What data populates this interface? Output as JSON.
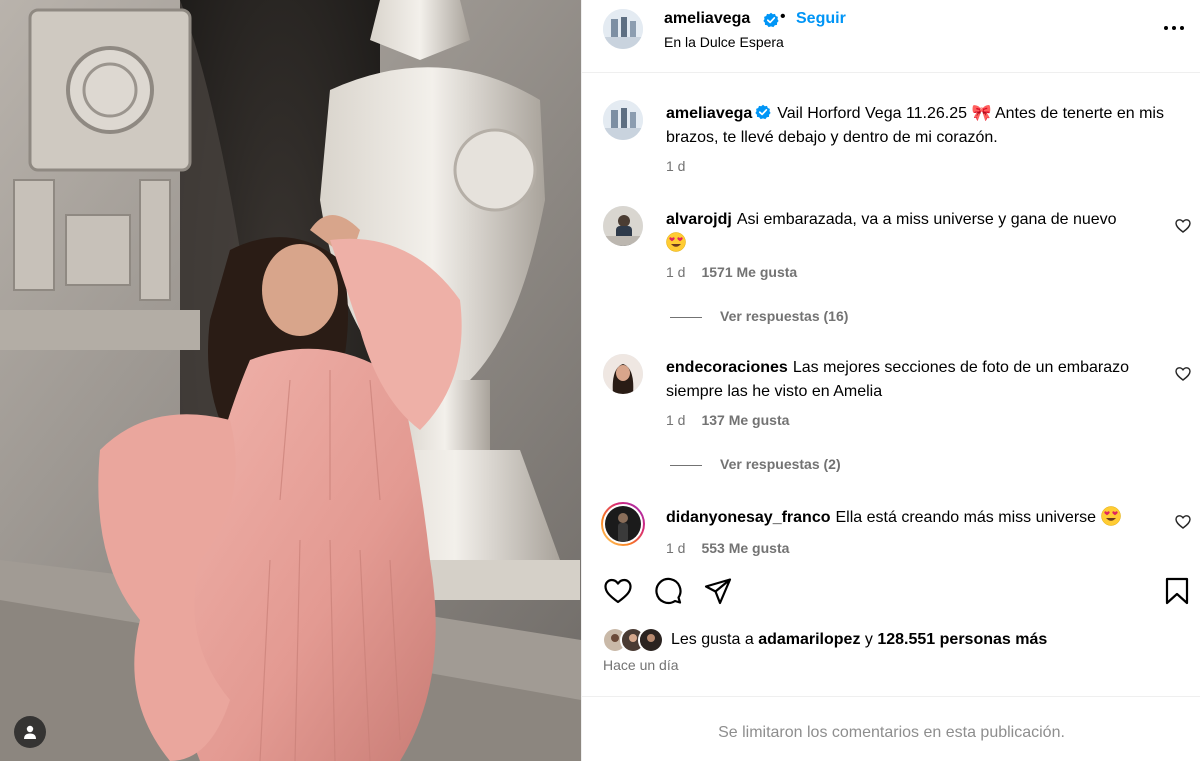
{
  "post": {
    "author": "ameliavega",
    "follow_label": "Seguir",
    "separator": "•",
    "location": "En la Dulce Espera",
    "caption": "Vail Horford Vega 11.26.25 🎀 Antes de tenerte en mis brazos, te llevé debajo y dentro de mi corazón.",
    "caption_time": "1 d",
    "time_ago": "Hace un día",
    "likes_prefix": "Les gusta a",
    "likes_user": "adamarilopez",
    "likes_joiner": "y",
    "likes_rest": "128.551 personas más",
    "comments_limited": "Se limitaron los comentarios en esta publicación.",
    "verified_color": "#0095f6"
  },
  "comments": [
    {
      "user": "alvarojdj",
      "text": "Asi embarazada, va a miss universe y gana de nuevo",
      "emoji": "heart-eyes",
      "time": "1 d",
      "likes": "1571 Me gusta",
      "replies": "Ver respuestas (16)"
    },
    {
      "user": "endecoraciones",
      "text": "Las mejores secciones de foto de un embarazo siempre las he visto en Amelia",
      "time": "1 d",
      "likes": "137 Me gusta",
      "replies": "Ver respuestas (2)"
    },
    {
      "user": "didanyonesay_franco",
      "text": "Ella está creando más miss universe",
      "emoji": "heart-eyes",
      "time": "1 d",
      "likes": "553 Me gusta"
    }
  ],
  "icons": {
    "like": "heart-icon",
    "comment": "comment-icon",
    "share": "share-icon",
    "save": "bookmark-icon",
    "more": "more-icon",
    "user": "user-icon"
  },
  "colors": {
    "accent": "#0095f6",
    "muted": "#737373",
    "dress": "#e8a39c"
  }
}
